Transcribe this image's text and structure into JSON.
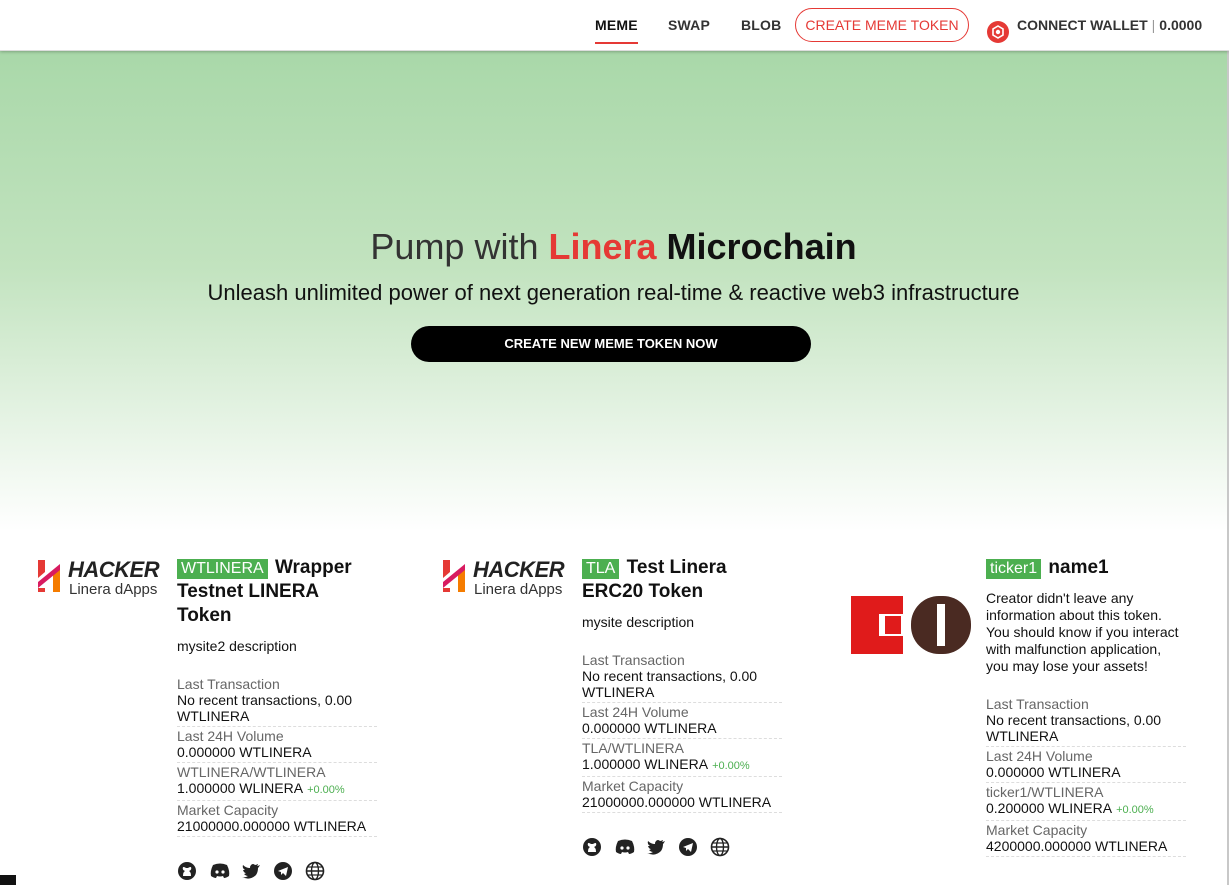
{
  "nav": {
    "items": [
      {
        "label": "MEME",
        "active": true
      },
      {
        "label": "SWAP",
        "active": false
      },
      {
        "label": "BLOB",
        "active": false
      }
    ],
    "create_label": "CREATE MEME TOKEN",
    "wallet_label": "CONNECT WALLET",
    "balance": "0.0000"
  },
  "hero": {
    "title_part1": "Pump with ",
    "title_part2": "Linera",
    "title_part3": "Microchain",
    "subtitle": "Unleash unlimited power of next generation real-time & reactive web3 infrastructure",
    "button_label": "CREATE NEW MEME TOKEN NOW"
  },
  "cards": [
    {
      "logo_title": "HACKER",
      "logo_subtitle": "Linera dApps",
      "ticker": "WTLINERA",
      "name": "Wrapper Testnet LINERA Token",
      "description": "mysite2 description",
      "last_tx_label": "Last Transaction",
      "last_tx_value": "No recent transactions, 0.00 WTLINERA",
      "volume_label": "Last 24H Volume",
      "volume_value": "0.000000 WTLINERA",
      "pair_label": "WTLINERA/WTLINERA",
      "pair_value": "1.000000 WLINERA",
      "pair_change": "+0.00%",
      "cap_label": "Market Capacity",
      "cap_value": "21000000.000000 WTLINERA"
    },
    {
      "logo_title": "HACKER",
      "logo_subtitle": "Linera dApps",
      "ticker": "TLA",
      "name": "Test Linera ERC20 Token",
      "description": "mysite description",
      "last_tx_label": "Last Transaction",
      "last_tx_value": "No recent transactions, 0.00 WTLINERA",
      "volume_label": "Last 24H Volume",
      "volume_value": "0.000000 WTLINERA",
      "pair_label": "TLA/WTLINERA",
      "pair_value": "1.000000 WLINERA",
      "pair_change": "+0.00%",
      "cap_label": "Market Capacity",
      "cap_value": "21000000.000000 WTLINERA"
    },
    {
      "ticker": "ticker1",
      "name": "name1",
      "description": "Creator didn't leave any information about this token. You should know if you interact with malfunction application, you may lose your assets!",
      "last_tx_label": "Last Transaction",
      "last_tx_value": "No recent transactions, 0.00 WTLINERA",
      "volume_label": "Last 24H Volume",
      "volume_value": "0.000000 WTLINERA",
      "pair_label": "ticker1/WTLINERA",
      "pair_value": "0.200000 WLINERA",
      "pair_change": "+0.00%",
      "cap_label": "Market Capacity",
      "cap_value": "4200000.000000 WTLINERA"
    }
  ],
  "social_icons": [
    "github-icon",
    "discord-icon",
    "twitter-icon",
    "telegram-icon",
    "globe-icon"
  ],
  "colors": {
    "accent": "#e53935",
    "ticker": "#4caf50",
    "hero_top": "#a9d8a9"
  }
}
